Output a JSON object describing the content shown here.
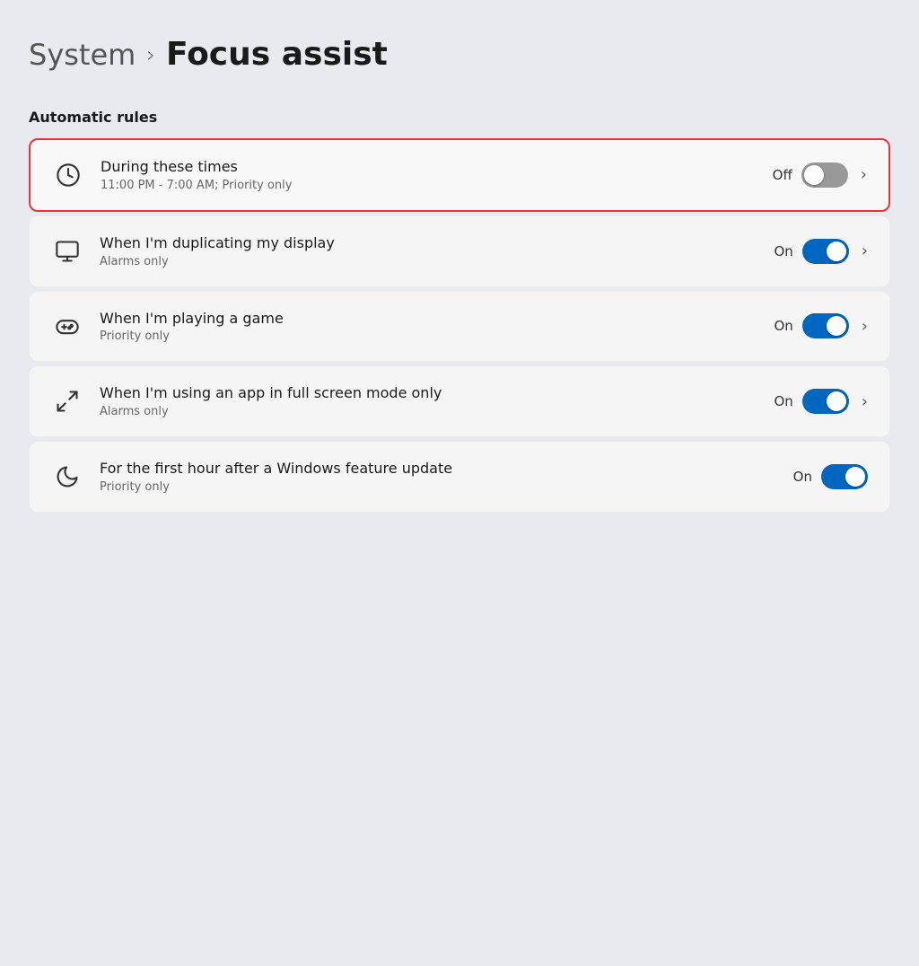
{
  "header": {
    "system_label": "System",
    "chevron": "›",
    "title": "Focus assist"
  },
  "section": {
    "label": "Automatic rules"
  },
  "rules": [
    {
      "id": "during-times",
      "title": "During these times",
      "subtitle": "11:00 PM - 7:00 AM; Priority only",
      "status": "Off",
      "toggle_state": "off",
      "highlighted": true,
      "icon": "clock"
    },
    {
      "id": "duplicating-display",
      "title": "When I'm duplicating my display",
      "subtitle": "Alarms only",
      "status": "On",
      "toggle_state": "on",
      "highlighted": false,
      "icon": "monitor"
    },
    {
      "id": "playing-game",
      "title": "When I'm playing a game",
      "subtitle": "Priority only",
      "status": "On",
      "toggle_state": "on",
      "highlighted": false,
      "icon": "gamepad"
    },
    {
      "id": "full-screen",
      "title": "When I'm using an app in full screen mode only",
      "subtitle": "Alarms only",
      "status": "On",
      "toggle_state": "on",
      "highlighted": false,
      "icon": "fullscreen"
    },
    {
      "id": "feature-update",
      "title": "For the first hour after a Windows feature update",
      "subtitle": "Priority only",
      "status": "On",
      "toggle_state": "on",
      "highlighted": false,
      "icon": "moon"
    }
  ]
}
